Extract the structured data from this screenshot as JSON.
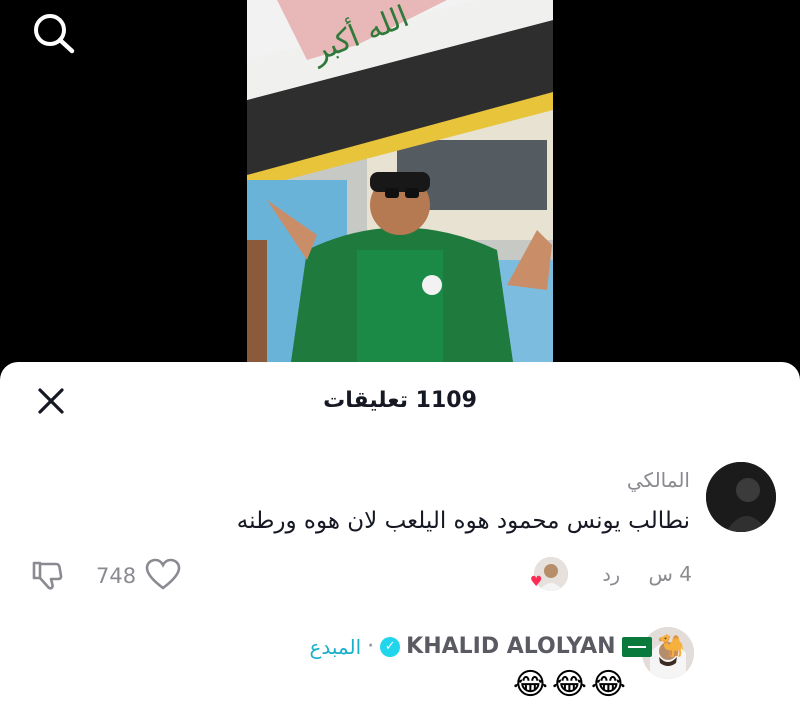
{
  "video": {
    "search_icon": "search-icon",
    "flag_text": "الله أكبر"
  },
  "comments_sheet": {
    "title": "1109 تعليقات",
    "close_icon": "close-icon",
    "comments": [
      {
        "username": "المالكي",
        "text": "نطالب يونس محمود هوه اليلعب لان هوه ورطنه",
        "time": "4 س",
        "reply_label": "رد",
        "like_count": "748",
        "liked_by_creator": true
      },
      {
        "username": "KHALID ALOLYAN",
        "emoji_camel": "🐪",
        "verified": true,
        "separator": "·",
        "creator_label": "المبدع",
        "text": "😂😂😂"
      }
    ]
  },
  "colors": {
    "primary_text": "#161823",
    "secondary_text": "#8a8b91",
    "creator_accent": "#1ab0c9",
    "verified_badge": "#20d5ec",
    "heart": "#fe2c55"
  }
}
